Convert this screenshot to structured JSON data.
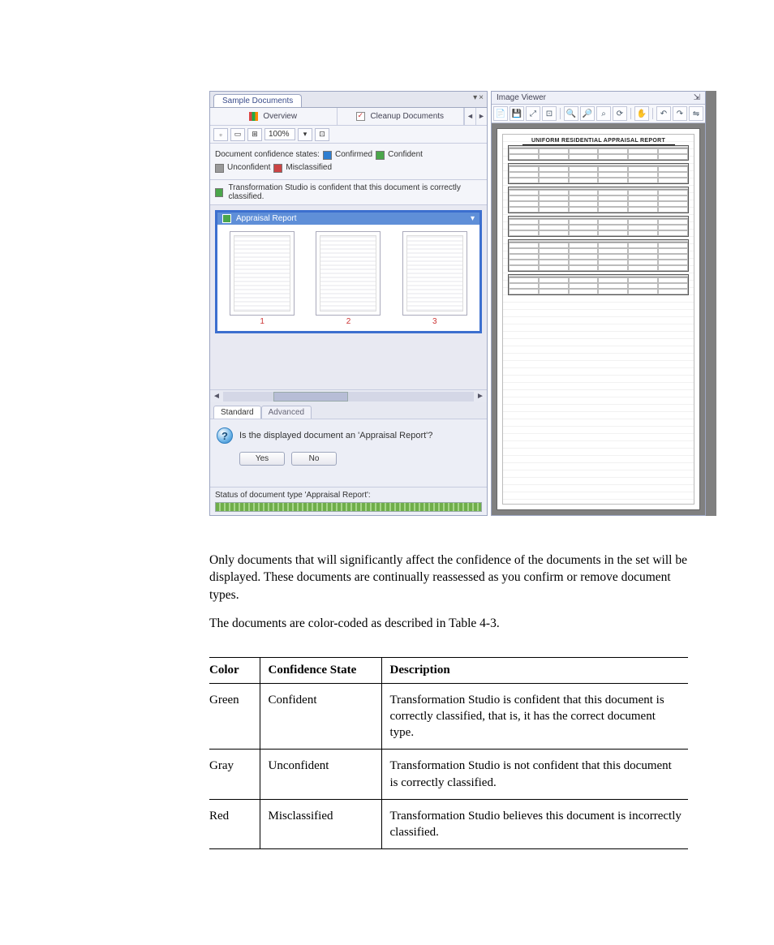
{
  "screenshot": {
    "topTab": "Sample Documents",
    "toolbar": {
      "overview": "Overview",
      "cleanup": "Cleanup Documents"
    },
    "zoom": "100%",
    "legend": {
      "label": "Document confidence states:",
      "confirmed": "Confirmed",
      "confident": "Confident",
      "unconfident": "Unconfident",
      "misclassified": "Misclassified"
    },
    "statusMsg": "Transformation Studio is confident that this document is correctly classified.",
    "groupTitle": "Appraisal Report",
    "thumbs": [
      "1",
      "2",
      "3"
    ],
    "secondaryTabs": {
      "standard": "Standard",
      "advanced": "Advanced"
    },
    "question": "Is the displayed document an 'Appraisal Report'?",
    "yes": "Yes",
    "no": "No",
    "statusBar": "Status of document type 'Appraisal Report':",
    "viewerTitle": "Image Viewer",
    "docHeading": "UNIFORM RESIDENTIAL APPRAISAL REPORT"
  },
  "para1": "Only documents that will significantly affect the confidence of the documents in the set will be displayed. These documents are continually reassessed as you confirm or remove document types.",
  "para2": "The documents are color-coded as described in Table 4-3.",
  "table": {
    "headers": {
      "color": "Color",
      "state": "Confidence State",
      "desc": "Description"
    },
    "rows": [
      {
        "color": "Green",
        "state": "Confident",
        "desc": "Transformation Studio is confident that this document is correctly classified, that is, it has the correct document type."
      },
      {
        "color": "Gray",
        "state": "Unconfident",
        "desc": "Transformation Studio is not confident that this document is correctly classified."
      },
      {
        "color": "Red",
        "state": "Misclassified",
        "desc": "Transformation Studio believes this document is incorrectly classified."
      }
    ]
  }
}
